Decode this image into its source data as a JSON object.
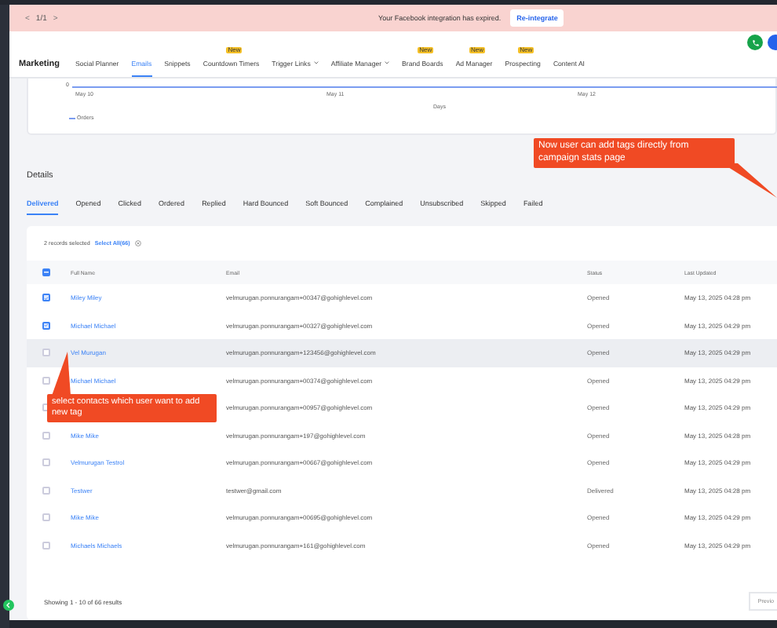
{
  "banner": {
    "pager": {
      "prev": "<",
      "count": "1/1",
      "next": ">"
    },
    "message": "Your Facebook integration has expired.",
    "action": "Re-integrate"
  },
  "header": {
    "title": "Marketing",
    "nav": [
      {
        "label": "Social Planner",
        "selected": false
      },
      {
        "label": "Emails",
        "selected": true
      },
      {
        "label": "Snippets",
        "selected": false
      },
      {
        "label": "Countdown Timers",
        "selected": false,
        "badge": "New"
      },
      {
        "label": "Trigger Links",
        "selected": false,
        "dropdown": true
      },
      {
        "label": "Affiliate Manager",
        "selected": false,
        "dropdown": true
      },
      {
        "label": "Brand Boards",
        "selected": false,
        "badge": "New"
      },
      {
        "label": "Ad Manager",
        "selected": false,
        "badge": "New"
      },
      {
        "label": "Prospecting",
        "selected": false,
        "badge": "New"
      },
      {
        "label": "Content AI",
        "selected": false
      }
    ]
  },
  "chart": {
    "y_label": "0",
    "x_labels": [
      "May 10",
      "May 11",
      "May 12"
    ],
    "axis_title": "Days",
    "legend": "Orders"
  },
  "callouts": [
    {
      "text": "Now user can add tags directly from campaign stats page"
    },
    {
      "text": "select contacts which user want to add new tag"
    }
  ],
  "details": {
    "title": "Details",
    "tabs": [
      {
        "label": "Delivered",
        "selected": true
      },
      {
        "label": "Opened",
        "selected": false
      },
      {
        "label": "Clicked",
        "selected": false
      },
      {
        "label": "Ordered",
        "selected": false
      },
      {
        "label": "Replied",
        "selected": false
      },
      {
        "label": "Hard Bounced",
        "selected": false
      },
      {
        "label": "Soft Bounced",
        "selected": false
      },
      {
        "label": "Complained",
        "selected": false
      },
      {
        "label": "Unsubscribed",
        "selected": false
      },
      {
        "label": "Skipped",
        "selected": false
      },
      {
        "label": "Failed",
        "selected": false
      }
    ],
    "select_all_partial": true,
    "selection": {
      "count": "2 records selected",
      "select_all": "Select All(66)"
    },
    "columns": [
      "Full Name",
      "Email",
      "Status",
      "Last Updated"
    ],
    "rows": [
      {
        "checked": true,
        "hovered": false,
        "name": "Miley Miley",
        "email": "velmurugan.ponnurangam+00347@gohighlevel.com",
        "status": "Opened",
        "updated": "May 13, 2025 04:28 pm"
      },
      {
        "checked": true,
        "hovered": false,
        "name": "Michael Michael",
        "email": "velmurugan.ponnurangam+00327@gohighlevel.com",
        "status": "Opened",
        "updated": "May 13, 2025 04:29 pm"
      },
      {
        "checked": false,
        "hovered": true,
        "name": "Vel Murugan",
        "email": "velmurugan.ponnurangam+123456@gohighlevel.com",
        "status": "Opened",
        "updated": "May 13, 2025 04:29 pm"
      },
      {
        "checked": false,
        "hovered": false,
        "name": "Michael Michael",
        "email": "velmurugan.ponnurangam+00374@gohighlevel.com",
        "status": "Opened",
        "updated": "May 13, 2025 04:29 pm"
      },
      {
        "checked": false,
        "hovered": false,
        "email": "velmurugan.ponnurangam+00957@gohighlevel.com",
        "status": "Opened",
        "updated": "May 13, 2025 04:29 pm"
      },
      {
        "checked": false,
        "hovered": false,
        "name": "Mike Mike",
        "email": "velmurugan.ponnurangam+197@gohighlevel.com",
        "status": "Opened",
        "updated": "May 13, 2025 04:28 pm"
      },
      {
        "checked": false,
        "hovered": false,
        "name": "Velmurugan Testrol",
        "email": "velmurugan.ponnurangam+00667@gohighlevel.com",
        "status": "Opened",
        "updated": "May 13, 2025 04:29 pm"
      },
      {
        "checked": false,
        "hovered": false,
        "name": "Testwer",
        "email": "testwer@gmail.com",
        "status": "Delivered",
        "updated": "May 13, 2025 04:28 pm"
      },
      {
        "checked": false,
        "hovered": false,
        "name": "Mike Mike",
        "email": "velmurugan.ponnurangam+00695@gohighlevel.com",
        "status": "Opened",
        "updated": "May 13, 2025 04:29 pm"
      },
      {
        "checked": false,
        "hovered": false,
        "name": "Michaels Michaels",
        "email": "velmurugan.ponnurangam+161@gohighlevel.com",
        "status": "Opened",
        "updated": "May 13, 2025 04:29 pm"
      }
    ],
    "footer": "Showing 1 - 10 of 66 results",
    "pager": "Previo"
  }
}
